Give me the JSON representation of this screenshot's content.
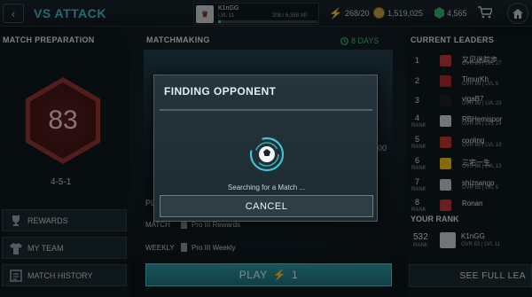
{
  "topbar": {
    "title": "VS ATTACK",
    "profile": {
      "name": "K1nGG",
      "level": "LVL 11",
      "xp": "208 / 6,358 XP",
      "xp_fraction": 0.03
    },
    "stamina": "268/20",
    "coins": "1,519,025",
    "points": "4,565",
    "icons": [
      "back-icon",
      "bolt-icon",
      "coin-icon",
      "gem-icon",
      "cart-icon",
      "home-icon"
    ]
  },
  "left": {
    "header": "MATCH PREPARATION",
    "ovr": "83",
    "formation": "4-5-1",
    "buttons": [
      {
        "label": "REWARDS",
        "icon": "trophy-icon"
      },
      {
        "label": "MY TEAM",
        "icon": "shirt-icon"
      },
      {
        "label": "MATCH HISTORY",
        "icon": "history-icon"
      }
    ]
  },
  "middle": {
    "header": "MATCHMAKING",
    "days": "8 DAYS",
    "partial_left": "PL",
    "partial_right": "00",
    "rows": [
      {
        "label": "MATCH",
        "value": "Pro III Rewards"
      },
      {
        "label": "WEEKLY",
        "value": "Pro III Weekly"
      }
    ],
    "play_label": "PLAY",
    "play_cost": "1"
  },
  "right": {
    "header": "CURRENT LEADERS",
    "rank_label": "RANK",
    "leaders": [
      {
        "rank": "1",
        "name": "又见迷踪步",
        "stats": "OVR 89 | LVL 27",
        "badge_color": "#c23b3b"
      },
      {
        "rank": "2",
        "name": "TimurKh",
        "stats": "OVR 89 | LVL 9",
        "badge_color": "#b8262b"
      },
      {
        "rank": "3",
        "name": "vigaB7",
        "stats": "OVR 88 | LVL 23",
        "badge_color": "#222222"
      },
      {
        "rank": "4",
        "name": "RBHemispor",
        "stats": "OVR 84 | LVL 14",
        "badge_color": "#d4d8da"
      },
      {
        "rank": "5",
        "name": "cooling",
        "stats": "OVR 85 | LVL 18",
        "badge_color": "#c4372c"
      },
      {
        "rank": "6",
        "name": "三宅一生",
        "stats": "OVR 86 | LVL 13",
        "badge_color": "#f0c419"
      },
      {
        "rank": "7",
        "name": "shiznango",
        "stats": "OVR 85 | LVL 9",
        "badge_color": "#c9ccce"
      },
      {
        "rank": "8",
        "name": "Ronan",
        "stats": "",
        "badge_color": "#c23b3b"
      }
    ],
    "your_rank_header": "YOUR RANK",
    "your_rank": {
      "rank": "532",
      "name": "K1nGG",
      "stats": "OVR 83 | LVL 11"
    },
    "see_full": "SEE FULL LEA"
  },
  "modal": {
    "title": "FINDING OPPONENT",
    "message": "Searching for a Match ...",
    "cancel_label": "CANCEL",
    "accent": "#3ec4d8"
  }
}
